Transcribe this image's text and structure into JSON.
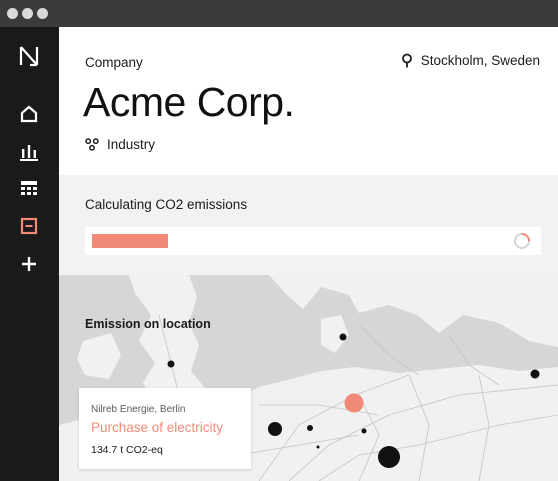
{
  "window": {
    "traffic_light_color": "#d9d9d9"
  },
  "sidebar": {
    "logo_icon": "n-logo-icon",
    "items": [
      {
        "name": "home",
        "icon": "home-icon",
        "active": false
      },
      {
        "name": "analytics",
        "icon": "bar-chart-icon",
        "active": false
      },
      {
        "name": "calculator",
        "icon": "calculator-icon",
        "active": false
      },
      {
        "name": "reports",
        "icon": "document-icon",
        "active": true
      },
      {
        "name": "add",
        "icon": "plus-icon",
        "active": false
      }
    ],
    "active_color": "#f08a76"
  },
  "header": {
    "company_label": "Company",
    "company_name": "Acme Corp.",
    "industry_label": "Industry",
    "location": "Stockholm, Sweden"
  },
  "calculation": {
    "title": "Calculating CO2 emissions",
    "progress_fraction": 0.19,
    "accent_color": "#f08a76"
  },
  "map": {
    "title": "Emission on location",
    "card": {
      "source": "Nilreb Energie, Berlin",
      "activity": "Purchase of electricity",
      "value": "134.7 t CO2-eq"
    }
  }
}
